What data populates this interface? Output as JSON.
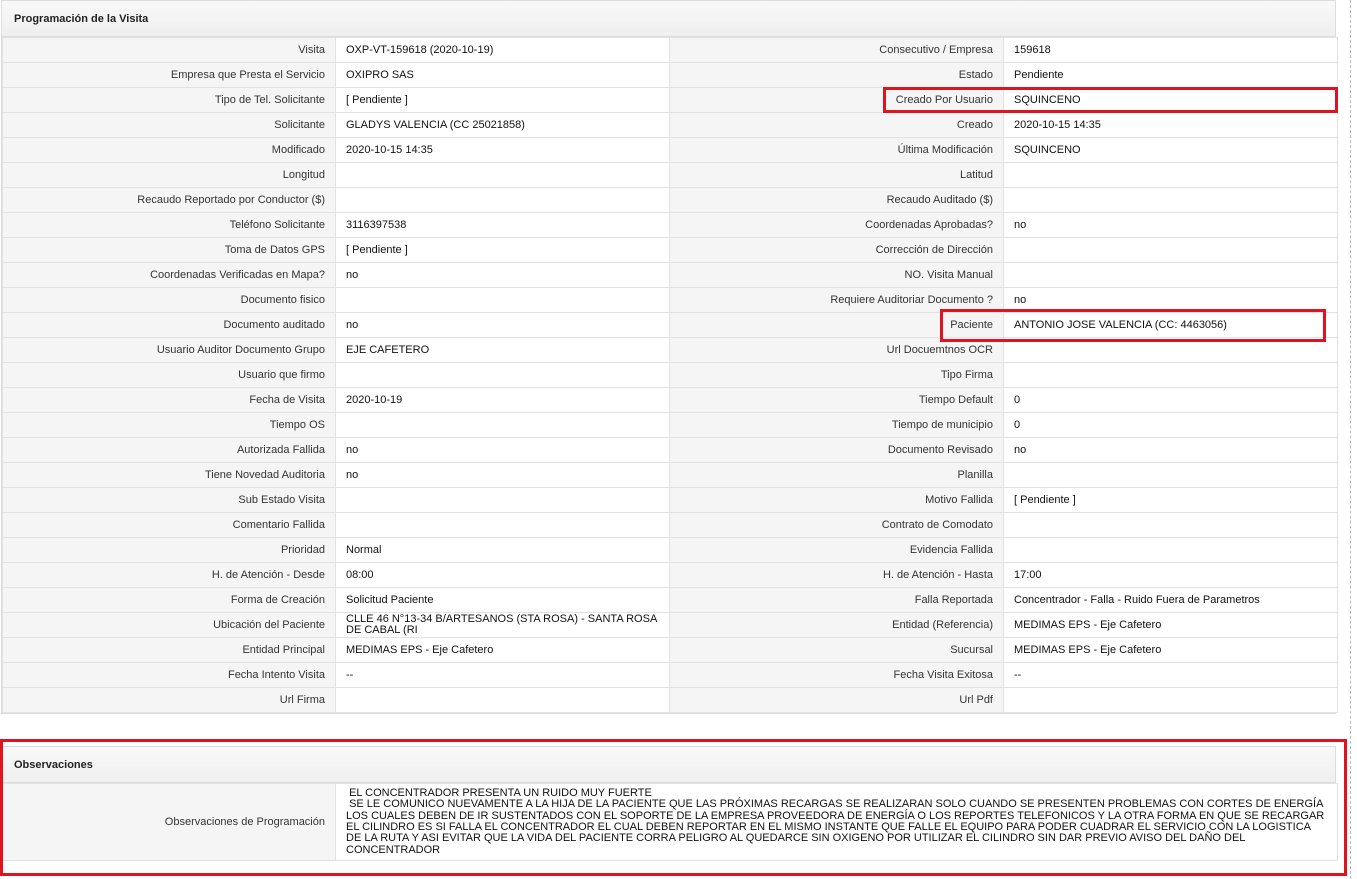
{
  "programacion": {
    "title": "Programación de la Visita",
    "rows": [
      {
        "l1": "Visita",
        "v1": "OXP-VT-159618 (2020-10-19)",
        "l2": "Consecutivo / Empresa",
        "v2": "159618"
      },
      {
        "l1": "Empresa que Presta el Servicio",
        "v1": "OXIPRO SAS",
        "l2": "Estado",
        "v2": "Pendiente"
      },
      {
        "l1": "Tipo de Tel. Solicitante",
        "v1": "[ Pendiente ]",
        "l2": "Creado Por Usuario",
        "v2": "SQUINCENO"
      },
      {
        "l1": "Solicitante",
        "v1": "GLADYS VALENCIA (CC 25021858)",
        "l2": "Creado",
        "v2": "2020-10-15 14:35"
      },
      {
        "l1": "Modificado",
        "v1": "2020-10-15 14:35",
        "l2": "Última Modificación",
        "v2": " SQUINCENO"
      },
      {
        "l1": "Longitud",
        "v1": "",
        "l2": "Latitud",
        "v2": ""
      },
      {
        "l1": "Recaudo Reportado por Conductor ($)",
        "v1": "",
        "l2": "Recaudo Auditado ($)",
        "v2": ""
      },
      {
        "l1": "Teléfono Solicitante",
        "v1": "3116397538",
        "l2": "Coordenadas Aprobadas?",
        "v2": " no"
      },
      {
        "l1": "Toma de Datos GPS",
        "v1": "[ Pendiente ]",
        "l2": "Corrección de Dirección",
        "v2": ""
      },
      {
        "l1": "Coordenadas Verificadas en Mapa?",
        "v1": " no",
        "l2": "NO. Visita Manual",
        "v2": ""
      },
      {
        "l1": "Documento fisico",
        "v1": "",
        "l2": "Requiere Auditoriar Documento ?",
        "v2": " no"
      },
      {
        "l1": "Documento auditado",
        "v1": " no",
        "l2": "Paciente",
        "v2": "ANTONIO JOSE VALENCIA (CC: 4463056)"
      },
      {
        "l1": "Usuario Auditor Documento Grupo",
        "v1": "EJE CAFETERO",
        "l2": "Url Docuemtnos OCR",
        "v2": ""
      },
      {
        "l1": "Usuario que firmo",
        "v1": "",
        "l2": "Tipo Firma",
        "v2": ""
      },
      {
        "l1": "Fecha de Visita",
        "v1": " 2020-10-19",
        "l2": "Tiempo Default",
        "v2": "0"
      },
      {
        "l1": "Tiempo OS",
        "v1": "",
        "l2": "Tiempo de municipio",
        "v2": "0"
      },
      {
        "l1": "Autorizada Fallida",
        "v1": " no",
        "l2": "Documento Revisado",
        "v2": " no"
      },
      {
        "l1": "Tiene Novedad Auditoria",
        "v1": " no",
        "l2": "Planilla",
        "v2": ""
      },
      {
        "l1": "Sub Estado Visita",
        "v1": "",
        "l2": "Motivo Fallida",
        "v2": "[ Pendiente ]"
      },
      {
        "l1": "Comentario Fallida",
        "v1": "",
        "l2": "Contrato de Comodato",
        "v2": ""
      },
      {
        "l1": "Prioridad",
        "v1": "Normal",
        "l2": "Evidencia Fallida",
        "v2": ""
      },
      {
        "l1": "H. de Atención - Desde",
        "v1": "08:00",
        "l2": "H. de Atención - Hasta",
        "v2": "17:00"
      },
      {
        "l1": "Forma de Creación",
        "v1": "Solicitud Paciente",
        "l2": "Falla Reportada",
        "v2": "Concentrador - Falla - Ruido Fuera de Parametros"
      },
      {
        "l1": "Ubicación del Paciente",
        "v1": "CLLE 46 N°13-34 B/ARTESANOS (STA ROSA) - SANTA ROSA DE CABAL (RI",
        "l2": "Entidad (Referencia)",
        "v2": "MEDIMAS EPS - Eje Cafetero"
      },
      {
        "l1": "Entidad Principal",
        "v1": "MEDIMAS EPS - Eje Cafetero",
        "l2": "Sucursal",
        "v2": "MEDIMAS EPS - Eje Cafetero"
      },
      {
        "l1": "Fecha Intento Visita",
        "v1": " --",
        "l2": "Fecha Visita Exitosa",
        "v2": " --"
      },
      {
        "l1": "Url Firma",
        "v1": "",
        "l2": "Url Pdf",
        "v2": ""
      }
    ]
  },
  "observaciones": {
    "title": "Observaciones",
    "label": "Observaciones de Programación",
    "text": " EL CONCENTRADOR PRESENTA UN RUIDO MUY FUERTE\n SE LE COMUNICO NUEVAMENTE A LA HIJA DE LA PACIENTE QUE LAS PRÓXIMAS RECARGAS SE REALIZARAN SOLO CUANDO SE PRESENTEN PROBLEMAS CON CORTES DE ENERGÍA LOS CUALES DEBEN DE IR SUSTENTADOS CON EL SOPORTE DE LA EMPRESA PROVEEDORA DE ENERGÍA O LOS REPORTES TELEFONICOS Y LA OTRA FORMA EN QUE SE RECARGAR EL CILINDRO ES SI FALLA EL CONCENTRADOR EL CUAL DEBEN REPORTAR EN EL MISMO INSTANTE QUE FALLE EL EQUIPO PARA PODER CUADRAR EL SERVICIO CON LA LOGISTICA DE LA RUTA Y ASI EVITAR QUE LA VIDA DEL PACIENTE CORRA PELIGRO AL QUEDARCE SIN OXIGENO POR UTILIZAR EL CILINDRO SIN DAR PREVIO AVISO DEL DAÑO DEL CONCENTRADOR"
  },
  "colors": {
    "highlight": "#e0141e",
    "label_bg": "#f5f5f5",
    "border": "#e2e2e2"
  }
}
